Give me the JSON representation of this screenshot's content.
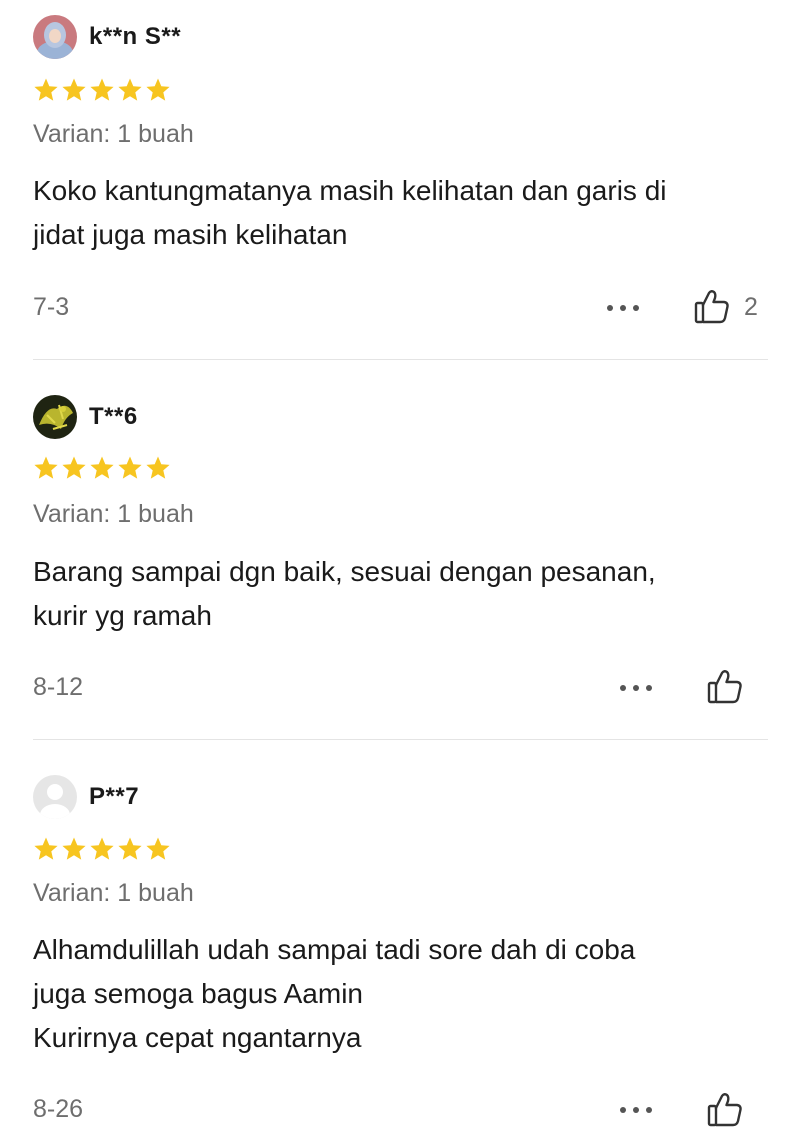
{
  "colors": {
    "star": "#F7C520",
    "muted_text": "#6e6e6e",
    "divider": "#e4e4e4"
  },
  "reviews": [
    {
      "username": "k**n S**",
      "avatar": "user-photo-hijab",
      "rating": 5,
      "variant": "Varian: 1 buah",
      "comment_lines": [
        "Koko kantungmatanya masih kelihatan dan garis di",
        "jidat juga masih kelihatan"
      ],
      "date": "7-3",
      "likes": "2"
    },
    {
      "username": "T**6",
      "avatar": "user-photo-plant",
      "rating": 5,
      "variant": "Varian: 1 buah",
      "comment_lines": [
        "Barang sampai dgn baik, sesuai dengan pesanan,",
        "kurir yg ramah"
      ],
      "date": "8-12",
      "likes": ""
    },
    {
      "username": "P**7",
      "avatar": "default-avatar",
      "rating": 5,
      "variant": "Varian: 1 buah",
      "comment_lines": [
        "Alhamdulillah udah sampai tadi sore dah di coba",
        "juga semoga bagus Aamin",
        "Kurirnya cepat ngantarnya"
      ],
      "date": "8-26",
      "likes": ""
    }
  ],
  "icons": {
    "star": "star-icon",
    "more": "more-options-icon",
    "like": "thumbs-up-icon"
  }
}
